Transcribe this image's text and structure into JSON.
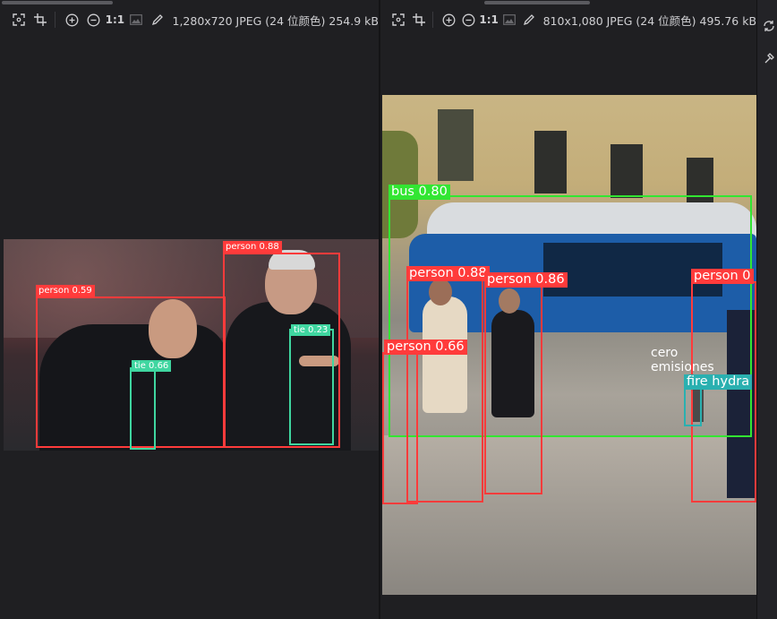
{
  "left_viewer": {
    "toolbar": {
      "icons": [
        "fit-screen-icon",
        "crop-icon",
        "zoom-in-icon",
        "zoom-out-icon"
      ],
      "actual_size_label": "1:1",
      "image_icon": "image-icon",
      "edit_icon": "pencil-icon",
      "file_info": "1,280x720 JPEG (24 位颜色) 254.9 kB"
    },
    "detections": [
      {
        "label": "person 0.88",
        "color": "#ff3b3b"
      },
      {
        "label": "person 0.59",
        "color": "#ff3b3b"
      },
      {
        "label": "tie 0.23",
        "color": "#3fd6a0"
      },
      {
        "label": "tie 0.66",
        "color": "#3fd6a0"
      }
    ]
  },
  "right_viewer": {
    "toolbar": {
      "icons": [
        "fit-screen-icon",
        "crop-icon",
        "zoom-in-icon",
        "zoom-out-icon"
      ],
      "actual_size_label": "1:1",
      "image_icon": "image-icon",
      "edit_icon": "pencil-icon",
      "file_info": "810x1,080 JPEG (24 位颜色) 495.76 kB"
    },
    "detections": [
      {
        "label": "bus 0.80",
        "color": "#32e632"
      },
      {
        "label": "person 0.88",
        "color": "#ff3b3b"
      },
      {
        "label": "person 0.86",
        "color": "#ff3b3b"
      },
      {
        "label": "person 0.66",
        "color": "#ff3b3b"
      },
      {
        "label": "person 0",
        "color": "#ff3b3b"
      },
      {
        "label": "fire hydra",
        "color": "#2ab0b0"
      }
    ],
    "bus_text": [
      "cero",
      "emisiones"
    ]
  },
  "side_panel": {
    "icons": [
      "sync-icon",
      "settings-icon"
    ]
  }
}
